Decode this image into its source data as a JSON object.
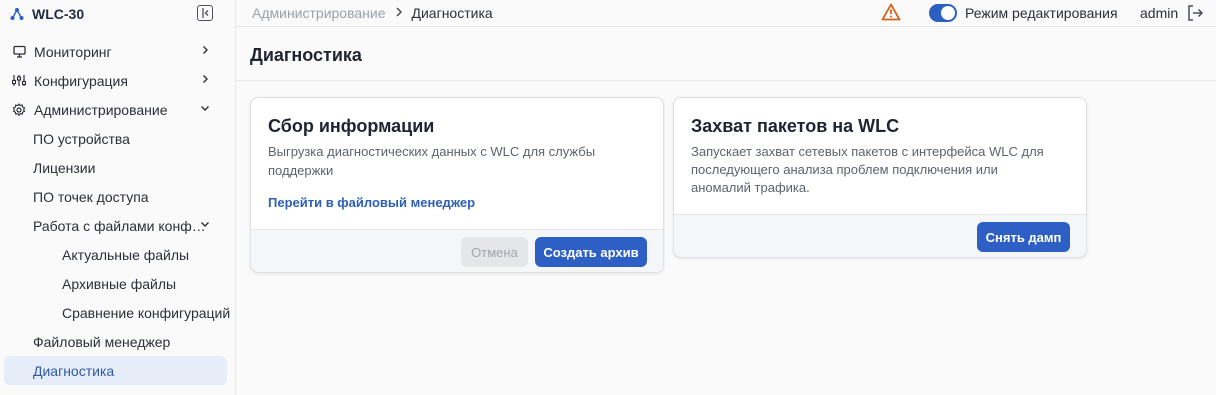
{
  "brand": {
    "name": "WLC-30"
  },
  "sidebar": {
    "items": [
      {
        "label": "Мониторинг"
      },
      {
        "label": "Конфигурация"
      },
      {
        "label": "Администрирование"
      },
      {
        "label": "ПО устройства"
      },
      {
        "label": "Лицензии"
      },
      {
        "label": "ПО точек доступа"
      },
      {
        "label": "Работа с файлами конф…"
      },
      {
        "label": "Актуальные файлы"
      },
      {
        "label": "Архивные файлы"
      },
      {
        "label": "Сравнение конфигураций"
      },
      {
        "label": "Файловый менеджер"
      },
      {
        "label": "Диагностика"
      }
    ]
  },
  "topbar": {
    "breadcrumb_parent": "Администрирование",
    "breadcrumb_current": "Диагностика",
    "edit_mode_label": "Режим редактирования",
    "edit_mode_on": true,
    "user": "admin"
  },
  "page": {
    "title": "Диагностика"
  },
  "cards": {
    "collect": {
      "title": "Сбор информации",
      "desc_line1": "Выгрузка диагностических данных с WLC для службы",
      "desc_line2": "поддержки",
      "link": "Перейти в файловый менеджер",
      "cancel": "Отмена",
      "create": "Создать архив"
    },
    "capture": {
      "title": "Захват пакетов на WLC",
      "desc_line1": "Запускает захват сетевых пакетов с интерфейса WLC для",
      "desc_line2": "последующего анализа проблем подключения или",
      "desc_line3": "аномалий трафика.",
      "dump": "Снять дамп"
    }
  },
  "colors": {
    "accent": "#2e5fc4",
    "active_bg": "#e6edf8",
    "warning": "#d0661d"
  }
}
